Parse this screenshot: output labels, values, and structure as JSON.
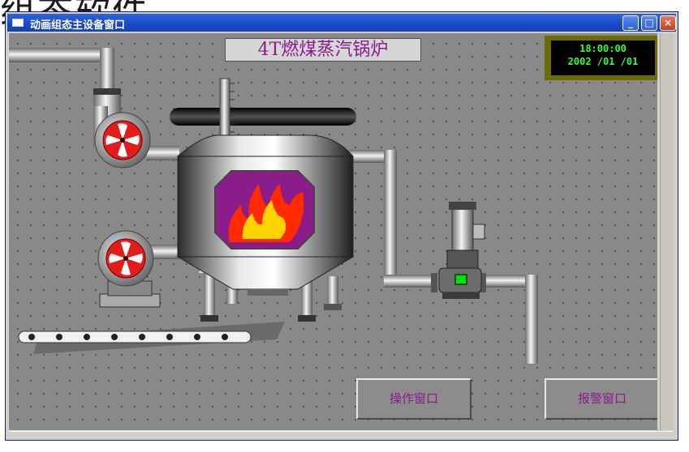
{
  "background_title": "组态软件",
  "window": {
    "title": "动画组态主设备窗口",
    "controls": {
      "minimize": "_",
      "maximize": "□",
      "close": "×"
    }
  },
  "scene": {
    "title": "4T燃煤蒸汽锅炉",
    "clock": {
      "time": "18:00:00",
      "date": "2002 /01 /01"
    },
    "buttons": {
      "operate": "操作窗口",
      "alarm": "报警窗口"
    }
  },
  "colors": {
    "accent": "#8a1d8a",
    "clock_text": "#32ff32",
    "flame": "#ff2a00",
    "fan": "#e31b1b"
  },
  "icons": [
    "fan-icon",
    "fire-icon",
    "pump-icon"
  ]
}
